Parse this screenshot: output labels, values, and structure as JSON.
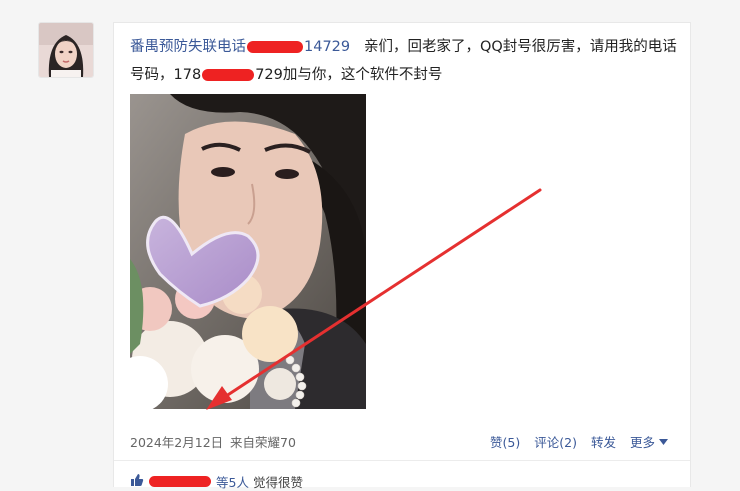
{
  "post": {
    "author": "番禺预防失联电话",
    "author_phone_end": "14729",
    "text_part1": "亲们，回老家了，QQ封号很厉害，请用我的电话",
    "text_part2_prefix": "号码，178",
    "text_part2_suffix": "729加与你，这个软件不封号"
  },
  "meta": {
    "date": "2024年2月12日",
    "source": "来自荣耀70",
    "like_label": "赞(5)",
    "comment_label": "评论(2)",
    "forward_label": "转发",
    "more_label": "更多"
  },
  "likes": {
    "names": "等5人",
    "suffix": "觉得很赞"
  },
  "colors": {
    "link": "#3b5998",
    "redaction": "#ee2222",
    "arrow": "#e53030"
  }
}
